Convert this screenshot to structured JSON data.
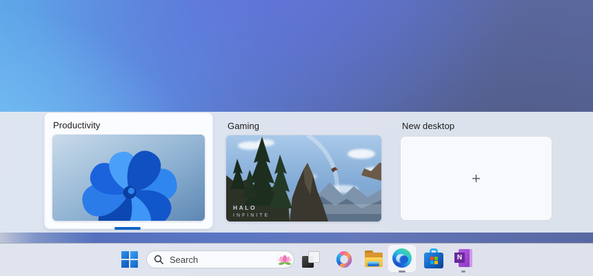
{
  "task_view": {
    "desktops": [
      {
        "label": "Productivity",
        "state": "selected",
        "wallpaper": "windows-11-bloom"
      },
      {
        "label": "Gaming",
        "state": "normal",
        "wallpaper": "halo-infinite",
        "caption_line1": "HALO",
        "caption_line2": "INFINITE"
      }
    ],
    "new_desktop": {
      "label": "New desktop",
      "plus_glyph": "+"
    },
    "selected_indicator_color": "#1063c5"
  },
  "taskbar": {
    "start": {
      "icon": "windows-logo"
    },
    "search": {
      "placeholder": "Search",
      "icon": "search-icon",
      "highlight_icon": "lotus-flower"
    },
    "buttons": [
      {
        "name": "task-view",
        "icon": "task-view-icon"
      },
      {
        "name": "copilot",
        "icon": "copilot-icon"
      },
      {
        "name": "file-explorer",
        "icon": "folder-icon"
      },
      {
        "name": "edge",
        "icon": "edge-icon",
        "state": "active",
        "running": true
      },
      {
        "name": "microsoft-store",
        "icon": "store-icon"
      },
      {
        "name": "onenote",
        "icon": "onenote-icon",
        "letter": "N",
        "running": true
      }
    ]
  },
  "colors": {
    "accent": "#1063c5",
    "band_bg": "#e1e6f0",
    "taskbar_bg": "#e3e6ee",
    "selected_card_bg": "#fcfdff"
  }
}
